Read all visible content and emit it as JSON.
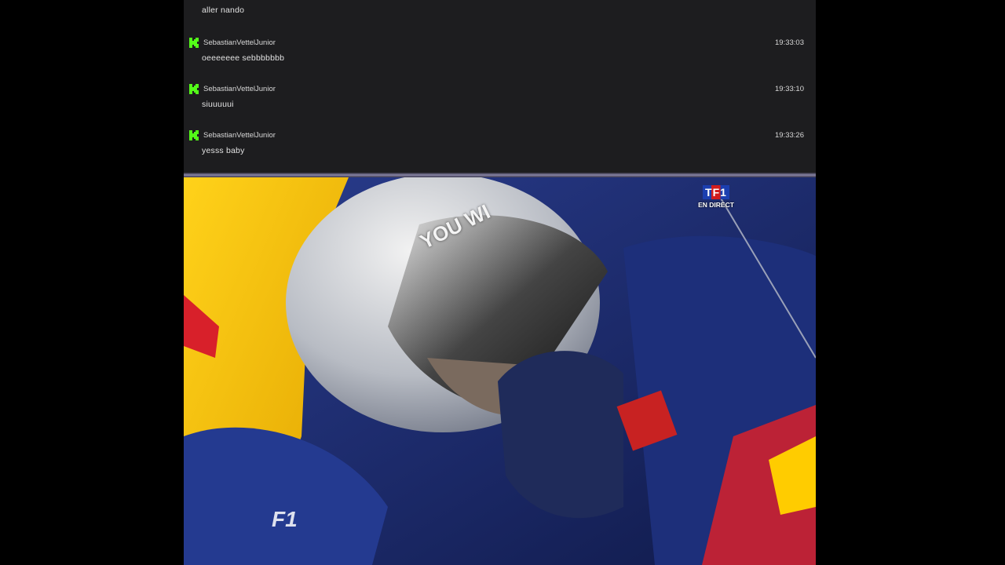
{
  "chat": {
    "messages": [
      {
        "username": "",
        "timestamp": "",
        "text": "aller nando"
      },
      {
        "username": "SebastianVettelJunior",
        "timestamp": "19:33:03",
        "text": "oeeeeeee sebbbbbbb"
      },
      {
        "username": "SebastianVettelJunior",
        "timestamp": "19:33:10",
        "text": "siuuuuui"
      },
      {
        "username": "SebastianVettelJunior",
        "timestamp": "19:33:26",
        "text": "yesss baby"
      }
    ]
  },
  "video": {
    "broadcaster": "TF1",
    "live_label": "EN DIRECT",
    "f1_logo": "F1",
    "visor_text": "YOU WI"
  },
  "colors": {
    "chat_bg": "#1d1d1f",
    "kick_green": "#53fc18"
  }
}
